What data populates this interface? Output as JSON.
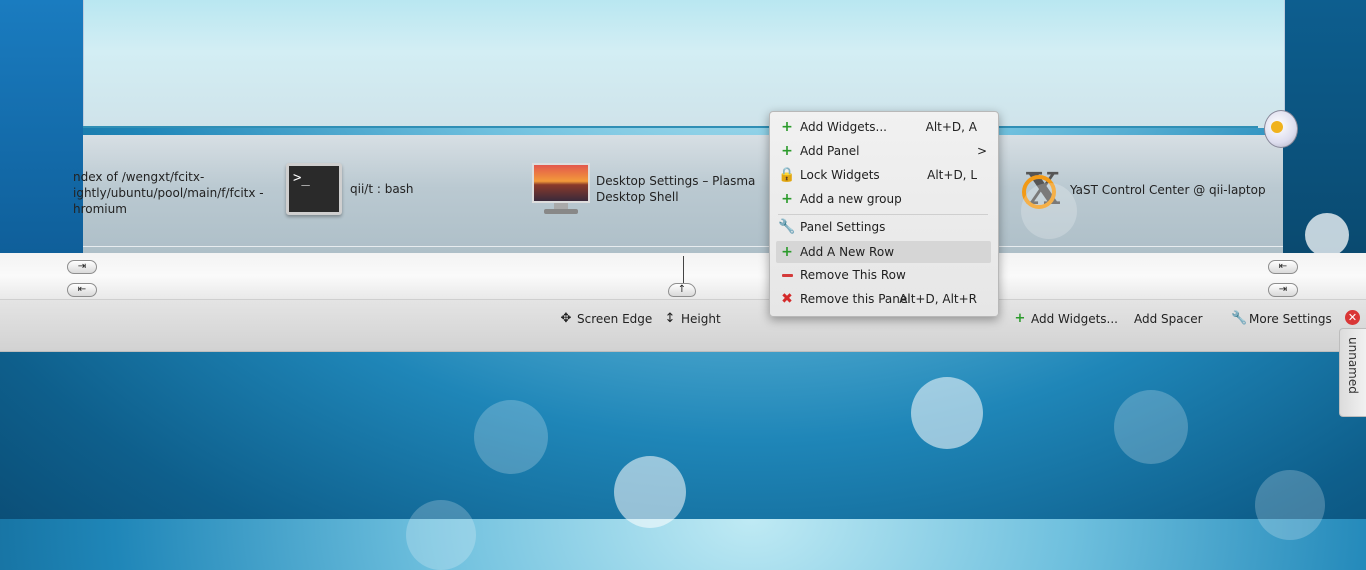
{
  "taskbar": {
    "tasks": [
      {
        "label_l1": "ndex of /wengxt/fcitx-",
        "label_l2": "ightly/ubuntu/pool/main/f/fcitx -",
        "label_l3": "hromium"
      },
      {
        "label": "qii/t : bash"
      },
      {
        "label_l1": "Desktop Settings – Plasma",
        "label_l2": "Desktop Shell"
      },
      {
        "label": "YaST Control Center @ qii-laptop"
      }
    ]
  },
  "menu": {
    "items": [
      {
        "label": "Add Widgets...",
        "shortcut": "Alt+D, A",
        "icon": "add-icon"
      },
      {
        "label": "Add Panel",
        "icon": "add-icon",
        "submenu": true
      },
      {
        "label": "Lock Widgets",
        "shortcut": "Alt+D, L",
        "icon": "lock-icon"
      },
      {
        "label": "Add a new group",
        "icon": "add-icon"
      },
      {
        "label": "Panel Settings",
        "icon": "wrench-icon"
      },
      {
        "label": "Add A New Row",
        "icon": "add-icon",
        "highlighted": true
      },
      {
        "label": "Remove This Row",
        "icon": "remove-icon"
      },
      {
        "label": "Remove this Panel",
        "shortcut": "Alt+D, Alt+R",
        "icon": "delete-icon"
      }
    ]
  },
  "toolbar": {
    "screen_edge": "Screen Edge",
    "height": "Height",
    "add_widgets": "Add Widgets...",
    "add_spacer": "Add Spacer",
    "more_settings": "More Settings"
  },
  "side_tab": "unnamed",
  "colors": {
    "accent": "#2f8fb5",
    "close": "#d93636",
    "plus": "#2c9b2c"
  }
}
